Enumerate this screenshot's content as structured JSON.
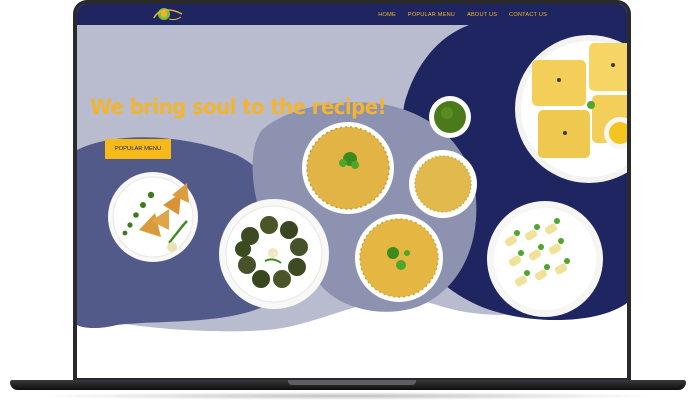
{
  "nav": {
    "logo_alt": "logo",
    "links": [
      "HOME",
      "POPULAR MENU",
      "ABOUT US",
      "CONTACT US"
    ]
  },
  "hero": {
    "headline": "We bring soul to the recipe!",
    "cta_label": "POPULAR MENU"
  },
  "colors": {
    "navbar": "#1e2560",
    "accent": "#f3b531",
    "button": "#f6b91a",
    "blob_light": "#b8bcce",
    "blob_mid": "#525a8a",
    "blob_dark": "#1e2560"
  },
  "dishes": [
    "samosa-plate",
    "patra-plate",
    "green-chutney-bowl",
    "khaman-bowl",
    "sev-bowl",
    "upma-bowl",
    "dhokla-plate",
    "khandvi-plate"
  ]
}
